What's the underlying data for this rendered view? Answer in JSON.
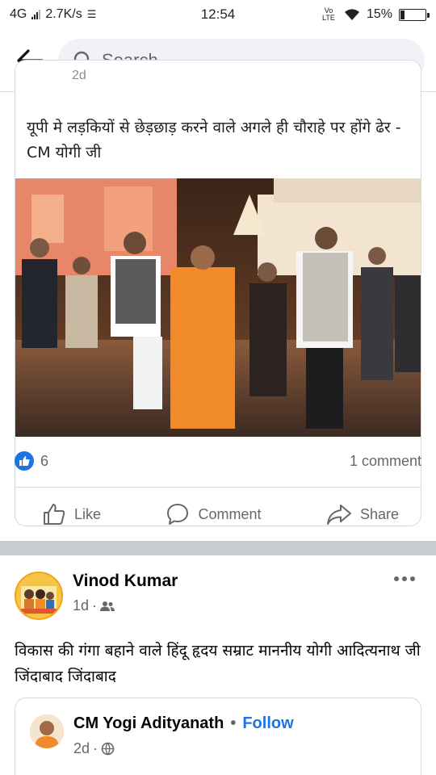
{
  "status_bar": {
    "network": "4G",
    "speed": "2.7K/s",
    "time": "12:54",
    "volte": "Vo LTE",
    "battery": "15%",
    "battery_level": 0.15
  },
  "top_bar": {
    "back_icon": "arrow-left-icon",
    "search_placeholder": "Search"
  },
  "post1": {
    "shared_meta": "2d",
    "shared_text": "यूपी मे लड़कियों से छेड़छाड़ करने वाले अगले ही चौराहे पर होंगे ढेर - CM योगी जी",
    "reaction_count": "6",
    "comment_count": "1 comment",
    "actions": {
      "like": "Like",
      "comment": "Comment",
      "share": "Share"
    }
  },
  "post2": {
    "author": "Vinod Kumar",
    "time": "1d",
    "audience_icon": "friends-icon",
    "text": "विकास की गंगा बहाने वाले हिंदू हृदय सम्राट माननीय योगी आदित्यनाथ जी जिंदाबाद जिंदाबाद",
    "shared_page": {
      "name": "CM Yogi Adityanath",
      "separator": "•",
      "follow": "Follow",
      "time": "2d",
      "audience_icon": "globe-icon"
    }
  },
  "colors": {
    "accent": "#1b74e4",
    "muted": "#65676b",
    "divider": "#c9ccd1"
  }
}
